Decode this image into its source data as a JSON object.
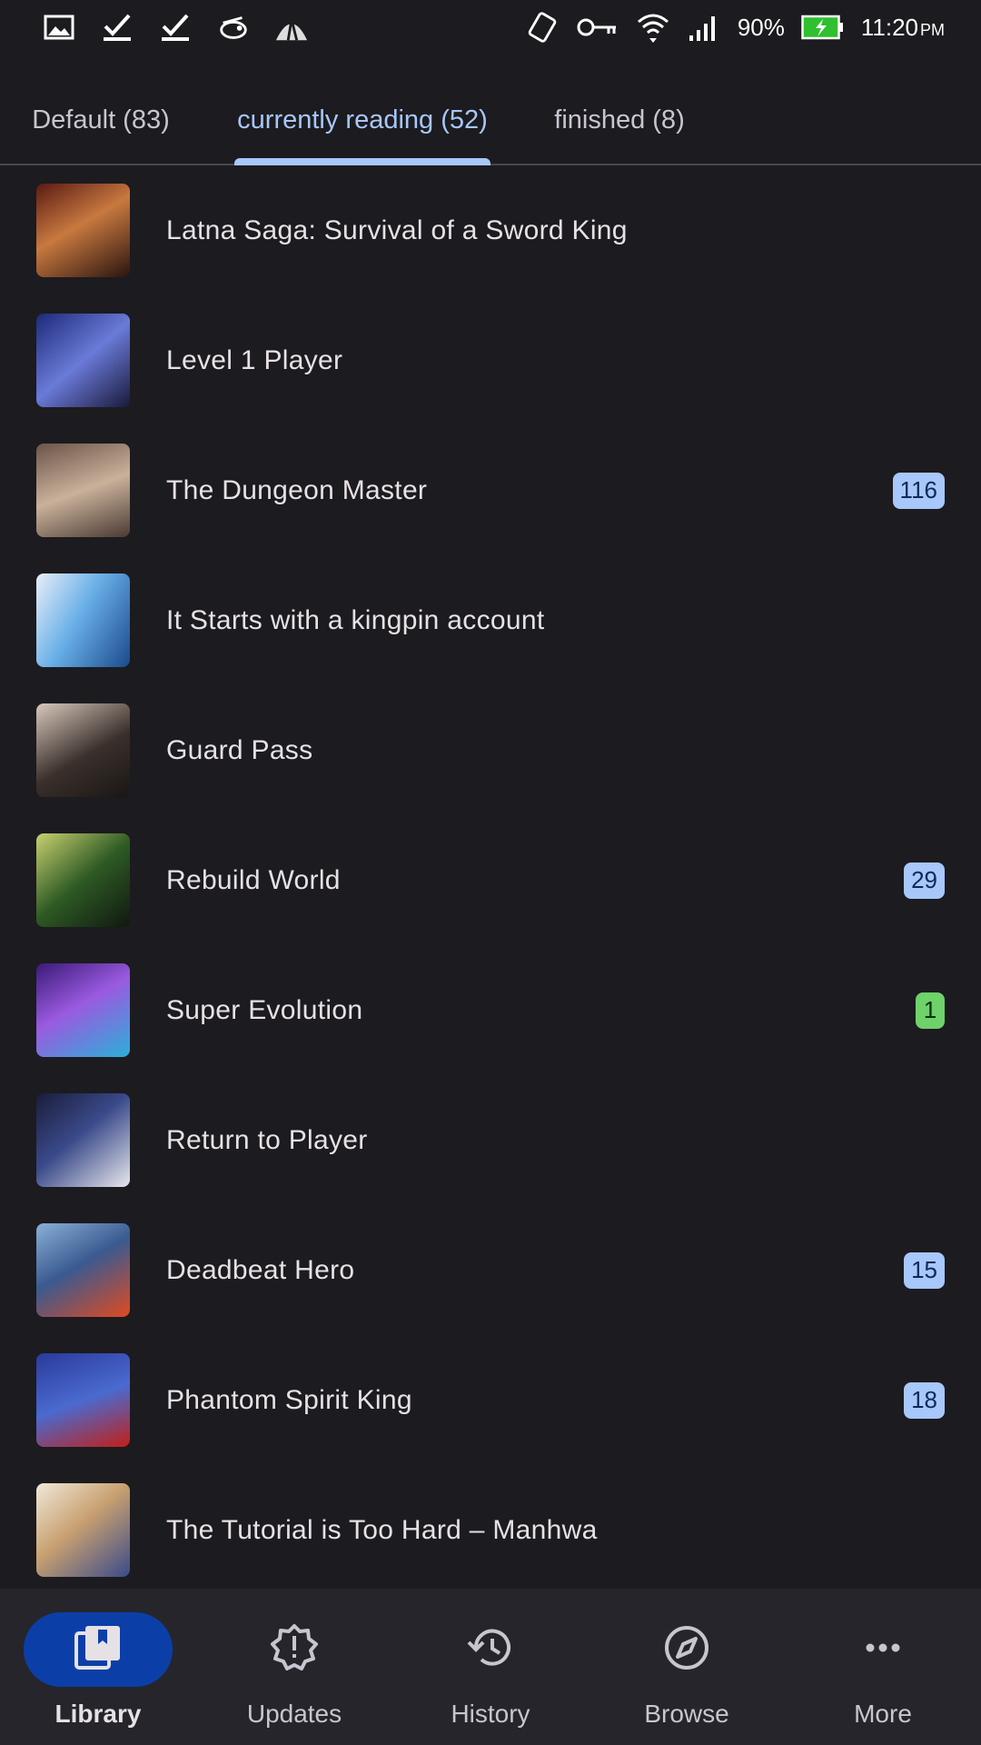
{
  "status_bar": {
    "battery": "90%",
    "time": "11:20",
    "ampm": "PM",
    "left_icons": [
      "image-icon",
      "check-icon",
      "check-icon",
      "bird-icon",
      "mountain-icon"
    ],
    "right_icons": [
      "vibrate-icon",
      "key-icon",
      "wifi-icon",
      "signal-icon",
      "battery-icon"
    ]
  },
  "tabs": [
    {
      "label": "Default (83)",
      "active": false
    },
    {
      "label": "currently reading (52)",
      "active": true
    },
    {
      "label": "finished (8)",
      "active": false
    }
  ],
  "library": {
    "items": [
      {
        "title": "Latna Saga: Survival of a Sword King",
        "badge": ""
      },
      {
        "title": "Level 1 Player",
        "badge": ""
      },
      {
        "title": "The Dungeon Master",
        "badge": "116"
      },
      {
        "title": "It Starts with a kingpin account",
        "badge": ""
      },
      {
        "title": "Guard Pass",
        "badge": ""
      },
      {
        "title": "Rebuild World",
        "badge": "29"
      },
      {
        "title": "Super Evolution",
        "badge": "1"
      },
      {
        "title": "Return to Player",
        "badge": ""
      },
      {
        "title": "Deadbeat Hero",
        "badge": "15"
      },
      {
        "title": "Phantom Spirit King",
        "badge": "18"
      },
      {
        "title": "The Tutorial is Too Hard – Manhwa",
        "badge": ""
      }
    ]
  },
  "bottom_nav": [
    {
      "label": "Library",
      "icon": "library-icon",
      "active": true
    },
    {
      "label": "Updates",
      "icon": "updates-icon",
      "active": false
    },
    {
      "label": "History",
      "icon": "history-icon",
      "active": false
    },
    {
      "label": "Browse",
      "icon": "compass-icon",
      "active": false
    },
    {
      "label": "More",
      "icon": "more-icon",
      "active": false
    }
  ],
  "colors": {
    "background": "#1c1b1f",
    "accent": "#a8c7fa",
    "nav_active": "#0b3fa7",
    "badge_blue": "#a8c7fa",
    "badge_green": "#6ed16a"
  }
}
